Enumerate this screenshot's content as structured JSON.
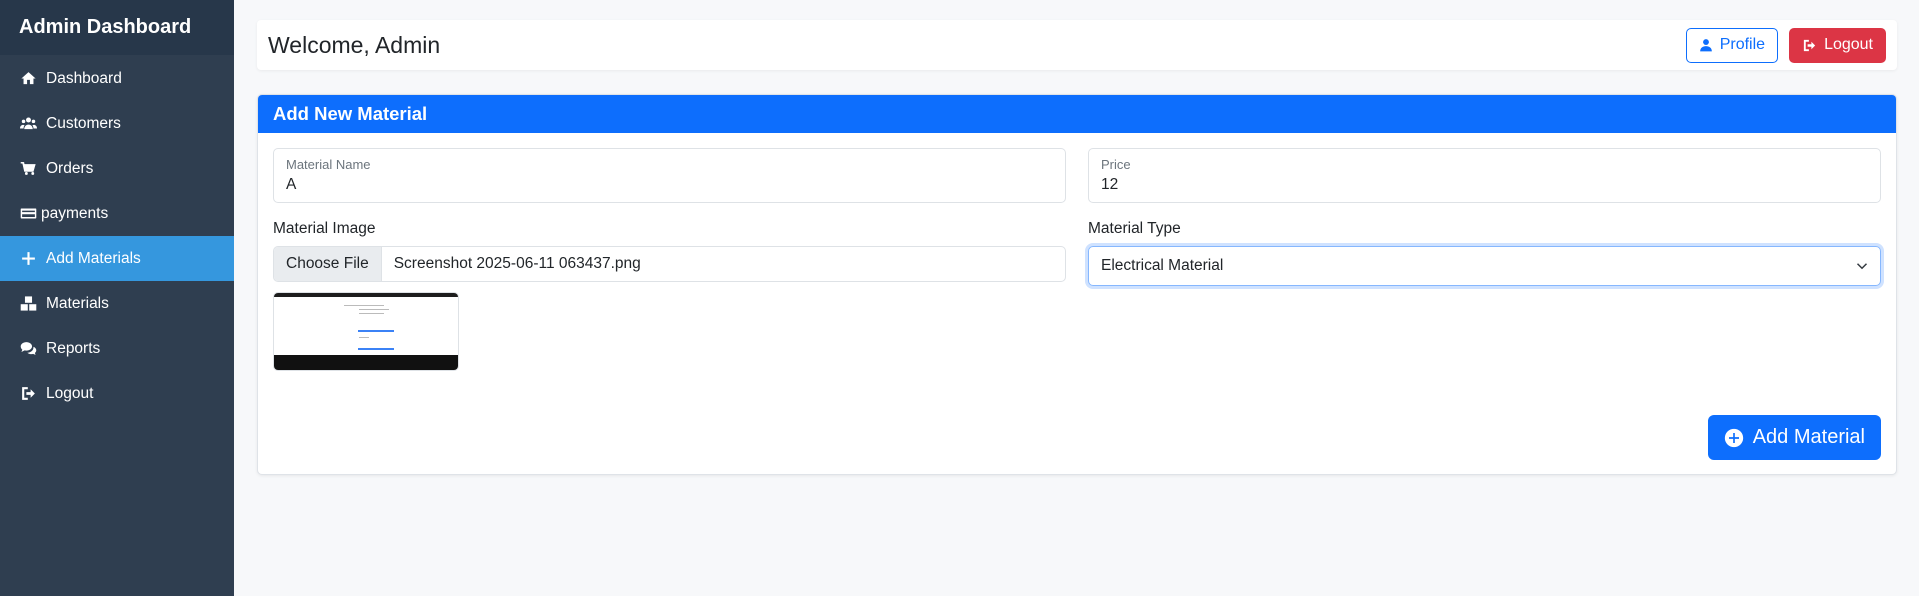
{
  "sidebar": {
    "title": "Admin Dashboard",
    "items": [
      {
        "label": "Dashboard",
        "icon": "home-icon"
      },
      {
        "label": "Customers",
        "icon": "users-icon"
      },
      {
        "label": "Orders",
        "icon": "cart-icon"
      },
      {
        "label": "payments",
        "icon": "credit-card-icon"
      },
      {
        "label": "Add Materials",
        "icon": "plus-icon",
        "active": true
      },
      {
        "label": "Materials",
        "icon": "boxes-icon"
      },
      {
        "label": "Reports",
        "icon": "comments-icon"
      },
      {
        "label": "Logout",
        "icon": "sign-out-icon"
      }
    ]
  },
  "header": {
    "welcome": "Welcome, Admin",
    "profile_label": "Profile",
    "logout_label": "Logout"
  },
  "form": {
    "title": "Add New Material",
    "material_name": {
      "label": "Material Name",
      "value": "A"
    },
    "price": {
      "label": "Price",
      "value": "12"
    },
    "image": {
      "label": "Material Image",
      "button": "Choose File",
      "filename": "Screenshot 2025-06-11 063437.png"
    },
    "type": {
      "label": "Material Type",
      "value": "Electrical Material"
    },
    "submit_label": "Add Material"
  },
  "colors": {
    "sidebar_bg": "#2f3e50",
    "active_item": "#3597de",
    "primary": "#0d6efd",
    "danger": "#dc3545"
  }
}
